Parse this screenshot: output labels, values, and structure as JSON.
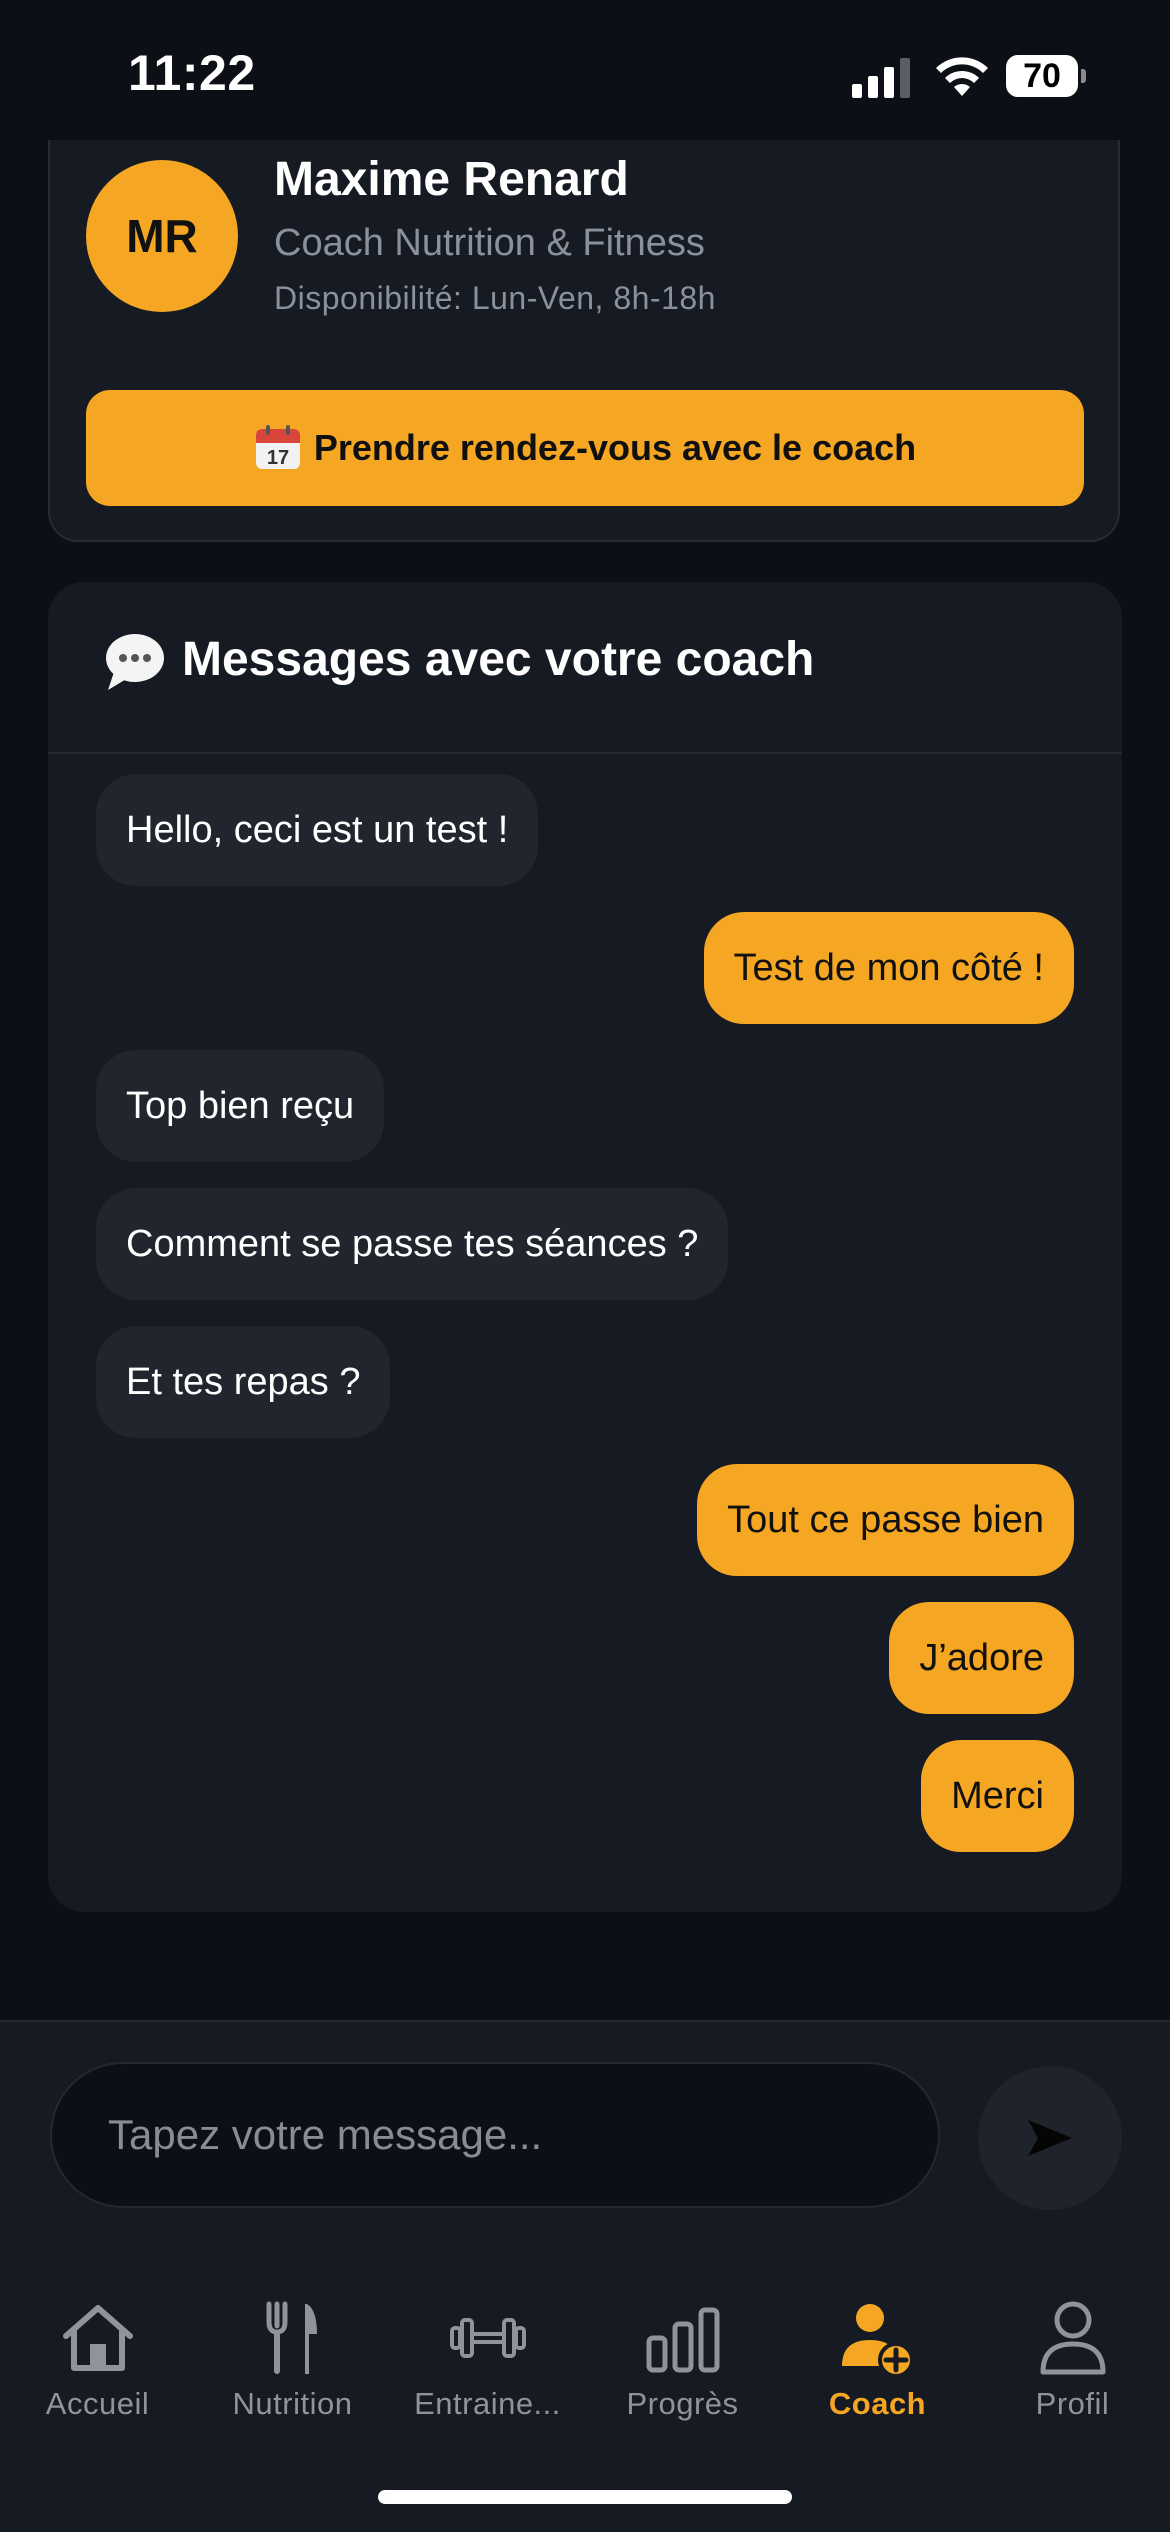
{
  "status_bar": {
    "time": "11:22",
    "battery": "70"
  },
  "coach": {
    "initials": "MR",
    "name": "Maxime Renard",
    "role": "Coach Nutrition & Fitness",
    "availability": "Disponibilité: Lun-Ven, 8h-18h",
    "appointment_button": "Prendre rendez-vous avec le coach"
  },
  "messages_section": {
    "title": "Messages avec votre coach",
    "messages": [
      {
        "from": "coach",
        "text": "Hello, ceci est un test !"
      },
      {
        "from": "user",
        "text": "Test de mon côté !"
      },
      {
        "from": "coach",
        "text": "Top bien reçu"
      },
      {
        "from": "coach",
        "text": "Comment se passe tes séances ?"
      },
      {
        "from": "coach",
        "text": "Et tes repas ?"
      },
      {
        "from": "user",
        "text": "Tout ce passe bien"
      },
      {
        "from": "user",
        "text": "J’adore"
      },
      {
        "from": "user",
        "text": "Merci"
      }
    ]
  },
  "composer": {
    "placeholder": "Tapez votre message..."
  },
  "tab_bar": {
    "tabs": [
      {
        "label": "Accueil",
        "icon": "home-icon"
      },
      {
        "label": "Nutrition",
        "icon": "fork-knife-icon"
      },
      {
        "label": "Entraine...",
        "icon": "dumbbell-icon"
      },
      {
        "label": "Progrès",
        "icon": "bar-chart-icon"
      },
      {
        "label": "Coach",
        "icon": "coach-add-icon"
      },
      {
        "label": "Profil",
        "icon": "profile-icon"
      }
    ],
    "active": "Coach"
  },
  "colors": {
    "accent": "#f5a623",
    "background": "#0c0f15",
    "card": "#161a22",
    "bubble_in": "#21252e"
  }
}
